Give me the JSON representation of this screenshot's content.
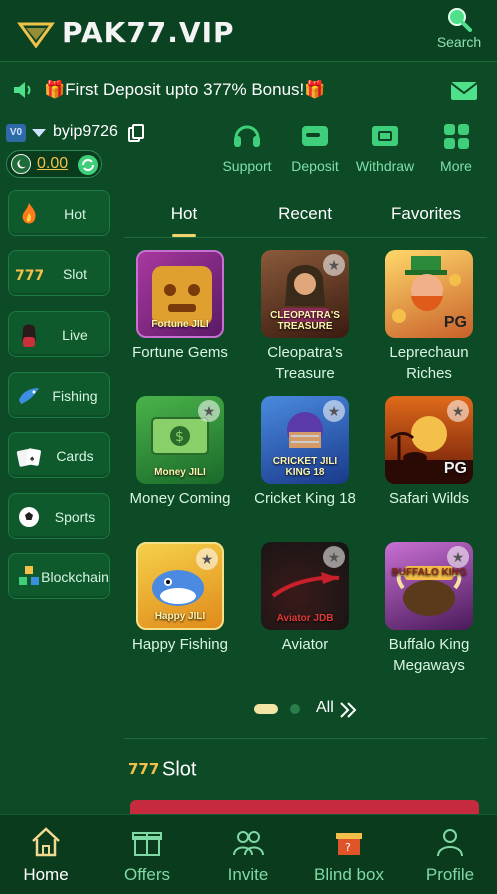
{
  "header": {
    "logo_text": "PAK77.VIP",
    "search_label": "Search"
  },
  "marquee": {
    "text": "First Deposit upto 377% Bonus!"
  },
  "user": {
    "vip_level": "V0",
    "username": "byip9726",
    "balance": "0.00"
  },
  "quick_actions": [
    {
      "label": "Support",
      "icon": "headset-icon"
    },
    {
      "label": "Deposit",
      "icon": "wallet-icon"
    },
    {
      "label": "Withdraw",
      "icon": "ticket-icon"
    },
    {
      "label": "More",
      "icon": "grid-icon"
    }
  ],
  "sidenav": [
    {
      "label": "Hot",
      "icon": "flame-icon"
    },
    {
      "label": "Slot",
      "icon": "slot-777-icon"
    },
    {
      "label": "Live",
      "icon": "live-dealer-icon"
    },
    {
      "label": "Fishing",
      "icon": "fish-icon"
    },
    {
      "label": "Cards",
      "icon": "cards-icon"
    },
    {
      "label": "Sports",
      "icon": "soccer-ball-icon"
    },
    {
      "label": "Blockchain",
      "icon": "blockchain-cubes-icon"
    }
  ],
  "tabs": [
    {
      "label": "Hot"
    },
    {
      "label": "Recent"
    },
    {
      "label": "Favorites"
    }
  ],
  "games": [
    {
      "name": "Fortune Gems",
      "tag": "Fortune JILI",
      "color": "#8a2b87"
    },
    {
      "name": "Cleopatra's Treasure",
      "tag": "CLEOPATRA'S TREASURE",
      "color": "#5a2a1c"
    },
    {
      "name": "Leprechaun Riches",
      "tag": "PG",
      "color": "#c25a2a"
    },
    {
      "name": "Money Coming",
      "tag": "Money JILI",
      "color": "#2e8a3a"
    },
    {
      "name": "Cricket King 18",
      "tag": "CRICKET JILI KING 18",
      "color": "#3560a8"
    },
    {
      "name": "Safari Wilds",
      "tag": "PG",
      "color": "#b44a15"
    },
    {
      "name": "Happy Fishing",
      "tag": "Happy JILI",
      "color": "#e8b22a"
    },
    {
      "name": "Aviator",
      "tag": "Aviator JDB",
      "color": "#1a1a1a"
    },
    {
      "name": "Buffalo King Megaways",
      "tag": "BUFFALO KING",
      "color": "#6e2a7a"
    }
  ],
  "pager": {
    "all_label": "All"
  },
  "section": {
    "title": "Slot"
  },
  "bottom_nav": [
    {
      "label": "Home",
      "icon": "home-icon",
      "active": true
    },
    {
      "label": "Offers",
      "icon": "gift-icon",
      "active": false
    },
    {
      "label": "Invite",
      "icon": "people-icon",
      "active": false
    },
    {
      "label": "Blind box",
      "icon": "mystery-box-icon",
      "active": false
    },
    {
      "label": "Profile",
      "icon": "person-icon",
      "active": false
    }
  ],
  "colors": {
    "background": "#0d4a26",
    "accent_gold": "#f5c04a",
    "label_green": "#7fe0a8"
  }
}
